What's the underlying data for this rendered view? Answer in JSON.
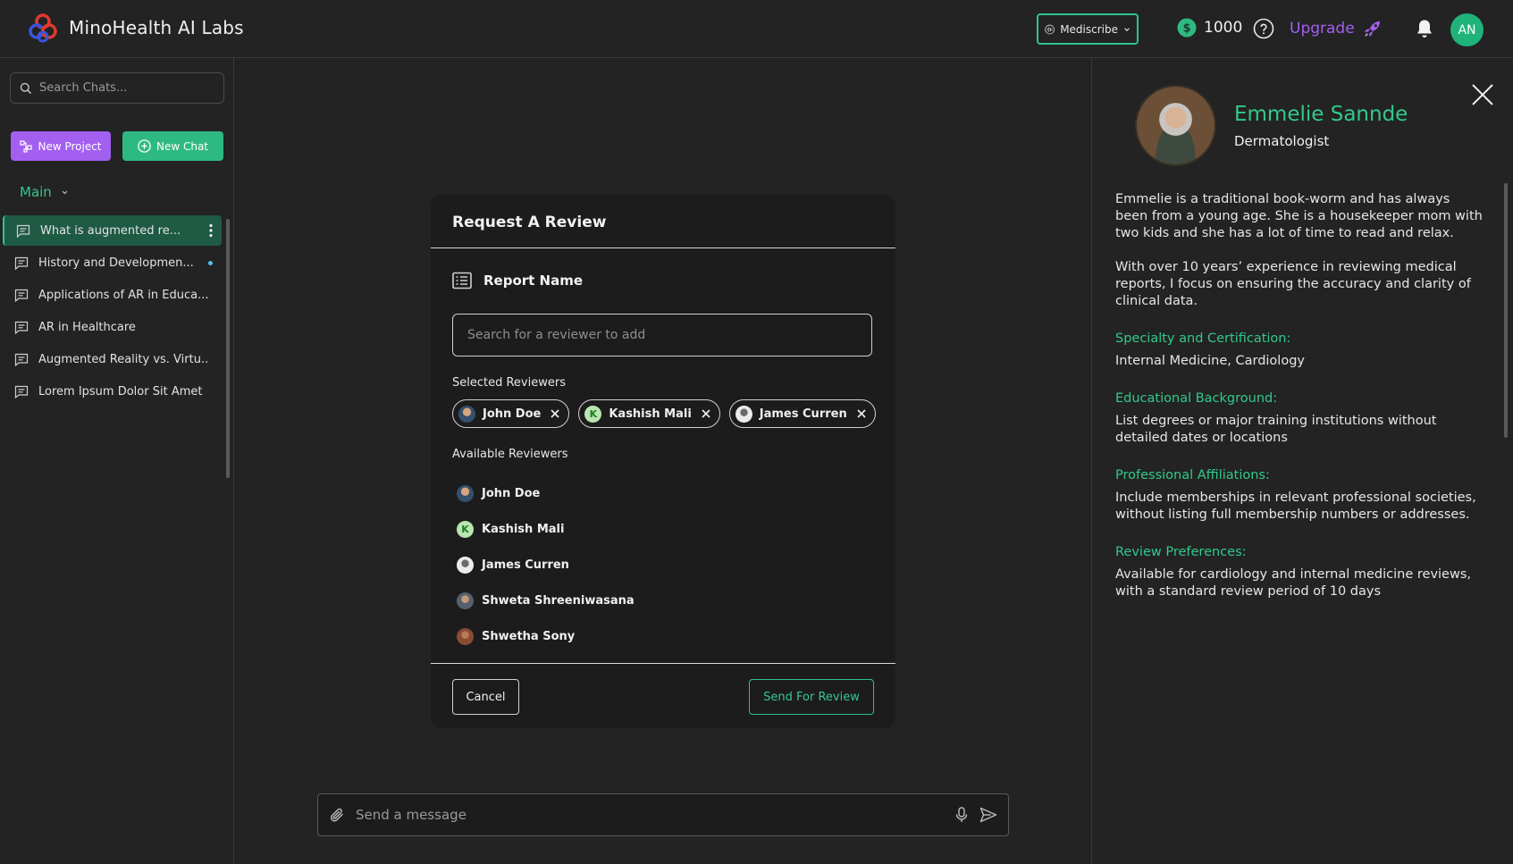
{
  "app": {
    "title": "MinoHealth AI Labs"
  },
  "header": {
    "model_selector": "Mediscribe",
    "credits": "1000",
    "upgrade_label": "Upgrade",
    "avatar_initials": "AN"
  },
  "sidebar": {
    "search_placeholder": "Search Chats...",
    "new_project_label": "New Project",
    "new_chat_label": "New Chat",
    "section_label": "Main",
    "items": [
      {
        "label": "What is augmented re...",
        "active": true
      },
      {
        "label": "History and Developmen...",
        "unread": true
      },
      {
        "label": "Applications of AR in Educa..."
      },
      {
        "label": "AR in Healthcare"
      },
      {
        "label": "Augmented Reality vs. Virtu..."
      },
      {
        "label": "Lorem Ipsum Dolor Sit Amet"
      }
    ]
  },
  "composer": {
    "placeholder": "Send a message"
  },
  "modal": {
    "title": "Request A Review",
    "report_name": "Report Name",
    "search_placeholder": "Search for a reviewer to add",
    "selected_label": "Selected Reviewers",
    "selected": [
      {
        "name": "John Doe",
        "avatar": "photo1"
      },
      {
        "name": "Kashish Mali",
        "avatar": "K"
      },
      {
        "name": "James Curren",
        "avatar": "photo2"
      }
    ],
    "available_label": "Available Reviewers",
    "available": [
      {
        "name": "John Doe",
        "avatar": "photo1"
      },
      {
        "name": "Kashish Mali",
        "avatar": "K"
      },
      {
        "name": "James Curren",
        "avatar": "photo2"
      },
      {
        "name": "Shweta Shreeniwasana",
        "avatar": "photo3"
      },
      {
        "name": "Shwetha Sony",
        "avatar": "photo4"
      }
    ],
    "cancel_label": "Cancel",
    "send_label": "Send For Review"
  },
  "profile": {
    "name": "Emmelie Sannde",
    "role": "Dermatologist",
    "bio1": "Emmelie is a traditional book-worm and has always been from a young age. She is a housekeeper mom with two kids and she has a lot of time to read and relax.",
    "bio2": "With over 10 years’ experience in reviewing medical reports, I focus on ensuring the accuracy and clarity of clinical data.",
    "specialty_heading": "Specialty and Certification:",
    "specialty_text": "Internal Medicine, Cardiology",
    "education_heading": "Educational Background:",
    "education_text": "List degrees or major training institutions without detailed dates or locations",
    "affiliations_heading": "Professional Affiliations:",
    "affiliations_text": "Include memberships in relevant professional societies, without listing full membership numbers or addresses.",
    "preferences_heading": "Review Preferences:",
    "preferences_text": "Available for cardiology and internal medicine reviews, with a standard review period of 10 days"
  },
  "colors": {
    "accent_green": "#2fc48d",
    "accent_purple": "#a35ff0",
    "background": "#232323"
  }
}
